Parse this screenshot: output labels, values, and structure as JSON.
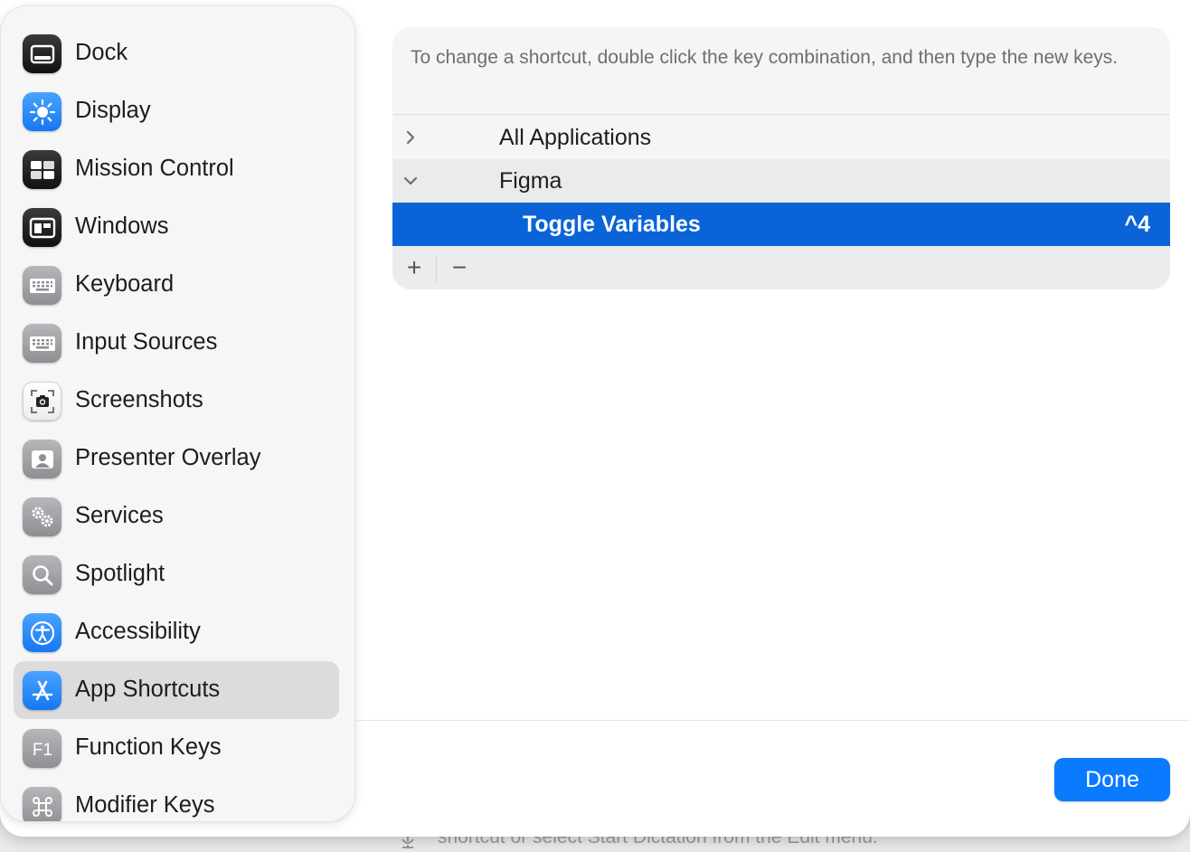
{
  "background": {
    "partial_text": "shortcut or select Start Dictation from the Edit menu."
  },
  "sidebar": {
    "items": [
      {
        "label": "Dock",
        "icon": "dock-icon"
      },
      {
        "label": "Display",
        "icon": "display-icon"
      },
      {
        "label": "Mission Control",
        "icon": "mission-control-icon"
      },
      {
        "label": "Windows",
        "icon": "windows-icon"
      },
      {
        "label": "Keyboard",
        "icon": "keyboard-icon"
      },
      {
        "label": "Input Sources",
        "icon": "input-sources-icon"
      },
      {
        "label": "Screenshots",
        "icon": "screenshots-icon"
      },
      {
        "label": "Presenter Overlay",
        "icon": "presenter-overlay-icon"
      },
      {
        "label": "Services",
        "icon": "services-icon"
      },
      {
        "label": "Spotlight",
        "icon": "spotlight-icon"
      },
      {
        "label": "Accessibility",
        "icon": "accessibility-icon"
      },
      {
        "label": "App Shortcuts",
        "icon": "app-shortcuts-icon",
        "selected": true
      },
      {
        "label": "Function Keys",
        "icon": "function-keys-icon"
      },
      {
        "label": "Modifier Keys",
        "icon": "modifier-keys-icon"
      }
    ]
  },
  "main": {
    "hint": "To change a shortcut, double click the key combination, and then type the new keys.",
    "rows": [
      {
        "label": "All Applications",
        "expanded": false
      },
      {
        "label": "Figma",
        "expanded": true
      },
      {
        "label": "Toggle Variables",
        "shortcut": "^4",
        "selected": true
      }
    ],
    "add_label": "+",
    "remove_label": "−"
  },
  "footer": {
    "done_label": "Done"
  },
  "colors": {
    "accent": "#0a7aff",
    "selection": "#0a64d8"
  }
}
